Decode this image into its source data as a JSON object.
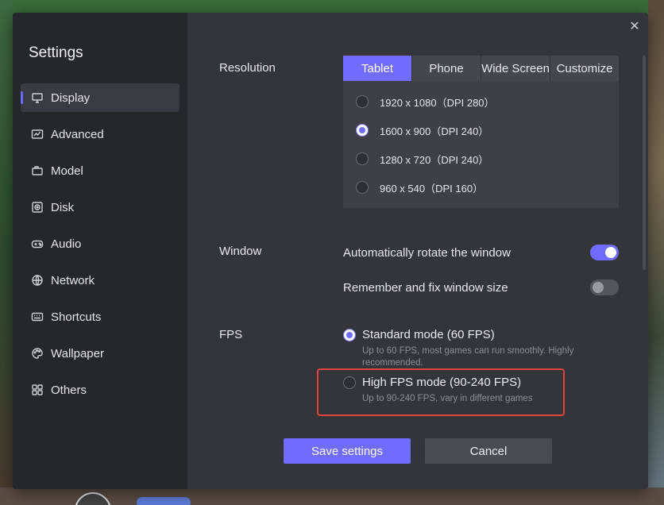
{
  "sidebar": {
    "title": "Settings",
    "items": [
      {
        "label": "Display",
        "icon": "monitor-icon",
        "active": true
      },
      {
        "label": "Advanced",
        "icon": "chart-icon",
        "active": false
      },
      {
        "label": "Model",
        "icon": "model-icon",
        "active": false
      },
      {
        "label": "Disk",
        "icon": "disk-icon",
        "active": false
      },
      {
        "label": "Audio",
        "icon": "gamepad-icon",
        "active": false
      },
      {
        "label": "Network",
        "icon": "globe-icon",
        "active": false
      },
      {
        "label": "Shortcuts",
        "icon": "keyboard-icon",
        "active": false
      },
      {
        "label": "Wallpaper",
        "icon": "palette-icon",
        "active": false
      },
      {
        "label": "Others",
        "icon": "grid-icon",
        "active": false
      }
    ]
  },
  "close_label": "✕",
  "resolution": {
    "label": "Resolution",
    "tabs": [
      "Tablet",
      "Phone",
      "Wide Screen",
      "Customize"
    ],
    "active_tab": "Tablet",
    "options": [
      {
        "text": "1920 x 1080（DPI 280）",
        "selected": false
      },
      {
        "text": "1600 x 900（DPI 240）",
        "selected": true
      },
      {
        "text": "1280 x 720（DPI 240）",
        "selected": false
      },
      {
        "text": "960 x 540（DPI 160）",
        "selected": false
      }
    ]
  },
  "window": {
    "label": "Window",
    "auto_rotate": {
      "text": "Automatically rotate the window",
      "on": true
    },
    "remember_size": {
      "text": "Remember and fix window size",
      "on": false
    }
  },
  "fps": {
    "label": "FPS",
    "standard": {
      "title": "Standard mode (60 FPS)",
      "desc": "Up to 60 FPS, most games can run smoothly. Highly recommended.",
      "selected": true
    },
    "high": {
      "title": "High FPS mode (90-240 FPS)",
      "desc": "Up to 90-240 FPS, vary in different games",
      "selected": false
    }
  },
  "buttons": {
    "save": "Save settings",
    "cancel": "Cancel"
  },
  "colors": {
    "accent": "#6f6cff",
    "highlight": "#e0443a",
    "panel": "#34353b",
    "sidebar": "#26272b"
  }
}
